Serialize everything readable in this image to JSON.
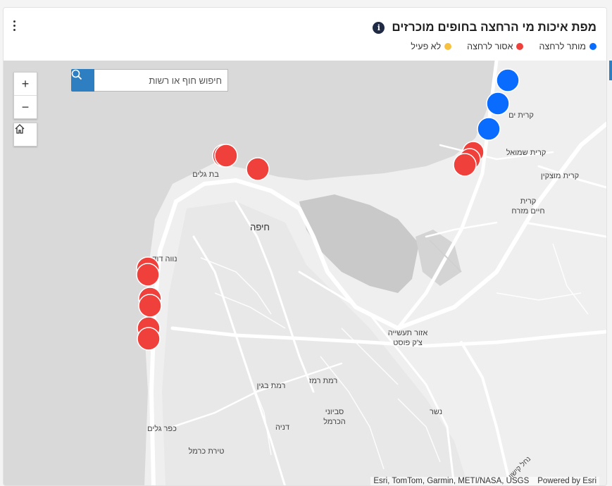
{
  "header": {
    "title": "מפת איכות מי הרחצה בחופים מוכרזים",
    "info_icon": "info-icon",
    "menu_icon": "vertical-dots-icon"
  },
  "legend": [
    {
      "label": "מותר לרחצה",
      "color": "#0a6cff"
    },
    {
      "label": "אסור לרחצה",
      "color": "#f0403c"
    },
    {
      "label": "לא פעיל",
      "color": "#f6c141"
    }
  ],
  "controls": {
    "zoom_in": "+",
    "zoom_out": "−",
    "home_icon": "home-icon",
    "search_icon": "search-icon",
    "search_placeholder": "חיפוש חוף או רשות"
  },
  "map_labels": {
    "kiryat_yam": "קרית ים",
    "kiryat_shmuel": "קרית שמואל",
    "kiryat_motzkin": "קרית מוצקין",
    "kiryat_haim_1": "קרית",
    "kiryat_haim_2": "חיים מזרח",
    "bat_galim": "בת גלים",
    "haifa": "חיפה",
    "neve_david": "נווה דוד",
    "industrial_1": "אזור תעשייה",
    "industrial_2": "צ'ק פוסט",
    "ramat_begin": "רמת בגין",
    "ramat_remez": "רמת רמז",
    "savyonei_1": "סביוני",
    "savyonei_2": "הכרמל",
    "nesher": "נשר",
    "denya": "דניה",
    "kfar_galim": "כפר גלים",
    "tirat_carmel": "טירת כרמל",
    "nahal_kishon": "נחל קישון"
  },
  "beaches": [
    {
      "status": "allowed"
    },
    {
      "status": "allowed"
    },
    {
      "status": "allowed"
    },
    {
      "status": "closed"
    },
    {
      "status": "closed"
    },
    {
      "status": "closed"
    },
    {
      "status": "closed"
    },
    {
      "status": "closed"
    },
    {
      "status": "closed"
    },
    {
      "status": "closed"
    },
    {
      "status": "closed"
    },
    {
      "status": "closed"
    },
    {
      "status": "closed"
    },
    {
      "status": "closed"
    },
    {
      "status": "closed"
    }
  ],
  "attribution": {
    "sources": "Esri, TomTom, Garmin, METI/NASA, USGS",
    "powered": "Powered by Esri"
  }
}
